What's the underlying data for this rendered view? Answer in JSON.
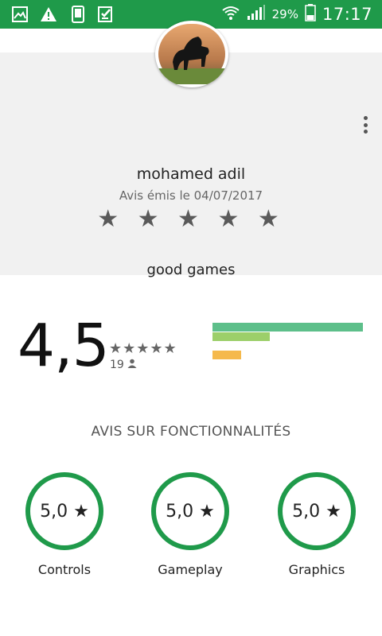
{
  "status_bar": {
    "battery_percent": "29%",
    "time": "17:17",
    "left_icons": [
      "gallery-icon",
      "warning-icon",
      "phone-icon",
      "checklist-icon"
    ],
    "right_icons": [
      "wifi-icon",
      "signal-icon",
      "battery-icon"
    ],
    "bg_color": "#1f9a4a"
  },
  "review": {
    "reviewer_name": "mohamed adil",
    "date": "Avis émis le 04/07/2017",
    "stars": 5,
    "stars_text": "★ ★ ★ ★ ★",
    "text": "good games"
  },
  "rating": {
    "average": "4,5",
    "stars_text": "★★★★★",
    "count": "19",
    "distribution": [
      {
        "stars": 5,
        "fraction": 1.0,
        "color": "#5dbf8a"
      },
      {
        "stars": 4,
        "fraction": 0.38,
        "color": "#9ccf6a"
      },
      {
        "stars": 3,
        "fraction": 0.0,
        "color": "#d8d85a"
      },
      {
        "stars": 2,
        "fraction": 0.19,
        "color": "#f5b94c"
      },
      {
        "stars": 1,
        "fraction": 0.0,
        "color": "#f08a5a"
      }
    ]
  },
  "features": {
    "title": "AVIS SUR FONCTIONNALITÉS",
    "items": [
      {
        "score": "5,0 ★",
        "label": "Controls"
      },
      {
        "score": "5,0 ★",
        "label": "Gameplay"
      },
      {
        "score": "5,0 ★",
        "label": "Graphics"
      }
    ],
    "ring_color": "#1f9a4a"
  }
}
